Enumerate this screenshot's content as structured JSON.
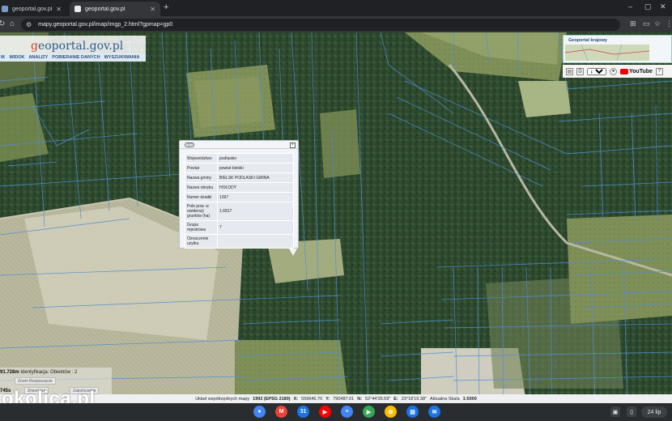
{
  "browser": {
    "tabs": [
      {
        "title": "geoportal.gov.pl – Geoportal I",
        "active": false
      },
      {
        "title": "geoportal.gov.pl",
        "active": true
      }
    ],
    "url": "mapy.geoportal.gov.pl/imap/imgp_2.html?gpmap=gp0"
  },
  "map": {
    "logo": {
      "prefix": "g",
      "rest": "eoportal.gov.pl"
    },
    "menu": [
      "IK",
      "WIDOK",
      "ANALIZY",
      "POBIERANIE DANYCH",
      "WYSZUKIWANIA"
    ],
    "overview_label": "Geoportal krajowy",
    "language": "pol",
    "youtube_label": "YouTube",
    "popup": {
      "rows": [
        {
          "key": "Województwo",
          "value": "podlaskie"
        },
        {
          "key": "Powiat",
          "value": "powiat bielski"
        },
        {
          "key": "Nazwa gminy",
          "value": "BIELSK PODLASKI GMINA"
        },
        {
          "key": "Nazwa obrębu",
          "value": "HOŁODY"
        },
        {
          "key": "Numer działki",
          "value": "1397"
        },
        {
          "key": "Pole pow. w ewidencji gruntów (ha)",
          "value": "1.6817"
        },
        {
          "key": "Grupa rejestrowa",
          "value": "7"
        },
        {
          "key": "Oznaczenie użytku",
          "value": ""
        }
      ]
    },
    "status": {
      "left_value": "91.728m",
      "identify_text": "Identyfikacja: Obiektów : 2",
      "second_value": "745s",
      "zoom_in_label": "Zoom Rozpoczęcie",
      "zoom_a_label": "Zmień kra",
      "zoom_b_label": "Zakończenie"
    },
    "coordbar": {
      "system_label": "Układ współrzędnych mapy",
      "system_value": "1992 (EPSG 2180)",
      "x_label": "X:",
      "x_value": "559646.70",
      "y_label": "Y:",
      "y_value": "790487.01",
      "n_label": "N:",
      "n_value": "52°44'35.59\"",
      "e_label": "E:",
      "e_value": "23°18'19.38\"",
      "scale_label": "Aktualna Skala",
      "scale_value": "1:5000"
    },
    "watermark": "okolica.pl"
  },
  "shelf": {
    "apps": [
      {
        "name": "chrome",
        "color": "#4285f4",
        "glyph": "●"
      },
      {
        "name": "gmail",
        "color": "#ea4335",
        "glyph": "M"
      },
      {
        "name": "calendar",
        "color": "#1a73e8",
        "glyph": "31"
      },
      {
        "name": "youtube",
        "color": "#ff0000",
        "glyph": "▶"
      },
      {
        "name": "docs",
        "color": "#4285f4",
        "glyph": "≡"
      },
      {
        "name": "play",
        "color": "#34a853",
        "glyph": "▶"
      },
      {
        "name": "photos",
        "color": "#fbbc04",
        "glyph": "✿"
      },
      {
        "name": "files",
        "color": "#1a73e8",
        "glyph": "▤"
      },
      {
        "name": "messages",
        "color": "#1a73e8",
        "glyph": "✉"
      }
    ],
    "date": "24 lip"
  }
}
